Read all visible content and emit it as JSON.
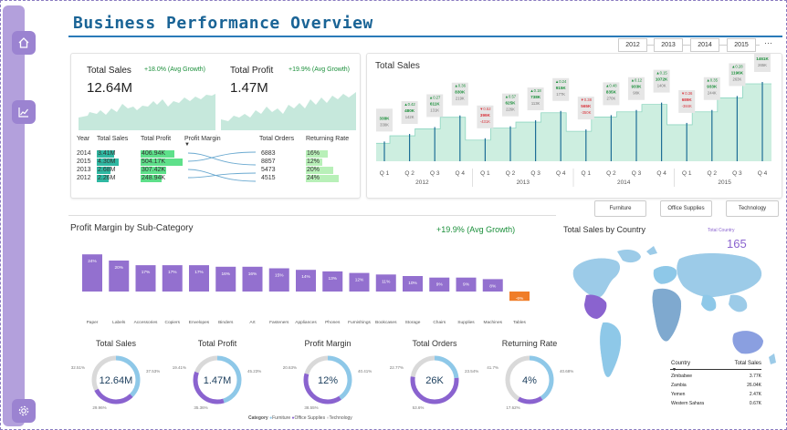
{
  "title": "Business Performance Overview",
  "year_buttons": [
    "2012",
    "2013",
    "2014",
    "2015"
  ],
  "kpis": {
    "total_sales": {
      "label": "Total Sales",
      "value": "12.64M",
      "growth": "+18.0% (Avg Growth)"
    },
    "total_profit": {
      "label": "Total Profit",
      "value": "1.47M",
      "growth": "+19.9% (Avg Growth)"
    }
  },
  "year_table": {
    "headers": [
      "Year",
      "Total Sales",
      "Total Profit",
      "Profit Margin",
      "Total Orders",
      "Returning Rate"
    ],
    "rows": [
      {
        "year": "2014",
        "sales": "3.41M",
        "profit": "406.94K",
        "orders": "6883",
        "rate": "16%",
        "sales_frac": 0.78,
        "profit_frac": 0.81,
        "rate_frac": 0.67
      },
      {
        "year": "2015",
        "sales": "4.30M",
        "profit": "504.17K",
        "orders": "8857",
        "rate": "12%",
        "sales_frac": 1.0,
        "profit_frac": 1.0,
        "rate_frac": 0.5
      },
      {
        "year": "2013",
        "sales": "2.68M",
        "profit": "307.42K",
        "orders": "5473",
        "rate": "20%",
        "sales_frac": 0.62,
        "profit_frac": 0.61,
        "rate_frac": 0.83
      },
      {
        "year": "2012",
        "sales": "2.26M",
        "profit": "248.94K",
        "orders": "4515",
        "rate": "24%",
        "sales_frac": 0.53,
        "profit_frac": 0.49,
        "rate_frac": 1.0
      }
    ]
  },
  "total_sales_chart": {
    "title": "Total Sales",
    "quarters": [
      "Q 1",
      "Q 2",
      "Q 3",
      "Q 4",
      "Q 1",
      "Q 2",
      "Q 3",
      "Q 4",
      "Q 1",
      "Q 2",
      "Q 3",
      "Q 4",
      "Q 1",
      "Q 2",
      "Q 3",
      "Q 4"
    ],
    "years": [
      "2012",
      "2013",
      "2014",
      "2015"
    ],
    "points": [
      {
        "val": "338K",
        "prev": "338K",
        "chg": "",
        "up": true
      },
      {
        "val": "480K",
        "prev": "142K",
        "chg": "▲0.42",
        "up": true
      },
      {
        "val": "611K",
        "prev": "131K",
        "chg": "▲0.27",
        "up": true
      },
      {
        "val": "830K",
        "prev": "219K",
        "chg": "▲0.36",
        "up": true
      },
      {
        "val": "399K",
        "prev": "-431K",
        "chg": "▼0.52",
        "up": false
      },
      {
        "val": "625K",
        "prev": "226K",
        "chg": "▲0.57",
        "up": true
      },
      {
        "val": "738K",
        "prev": "113K",
        "chg": "▲0.18",
        "up": true
      },
      {
        "val": "915K",
        "prev": "177K",
        "chg": "▲0.24",
        "up": true
      },
      {
        "val": "565K",
        "prev": "-350K",
        "chg": "▼0.38",
        "up": false
      },
      {
        "val": "835K",
        "prev": "270K",
        "chg": "▲0.48",
        "up": true
      },
      {
        "val": "933K",
        "prev": "98K",
        "chg": "▲0.12",
        "up": true
      },
      {
        "val": "1072K",
        "prev": "140K",
        "chg": "▲0.15",
        "up": true
      },
      {
        "val": "689K",
        "prev": "-384K",
        "chg": "▼0.36",
        "up": false
      },
      {
        "val": "933K",
        "prev": "244K",
        "chg": "▲0.35",
        "up": true
      },
      {
        "val": "1196K",
        "prev": "263K",
        "chg": "▲0.28",
        "up": true
      },
      {
        "val": "1461K",
        "prev": "265K",
        "chg": "▲0.24",
        "up": true
      }
    ]
  },
  "category_buttons": [
    "Furniture",
    "Office Supplies",
    "Technology"
  ],
  "chart_data": {
    "type": "bar",
    "title": "Profit Margin by Sub-Category",
    "growth": "+19.9% (Avg Growth)",
    "categories": [
      "Paper",
      "Labels",
      "Accessories",
      "Copiers",
      "Envelopes",
      "Binders",
      "Art",
      "Fasteners",
      "Appliances",
      "Phones",
      "Furnishings",
      "Bookcases",
      "Storage",
      "Chairs",
      "Supplies",
      "Machines",
      "Tables"
    ],
    "values": [
      24,
      20,
      17,
      17,
      17,
      16,
      16,
      15,
      14,
      13,
      12,
      11,
      10,
      9,
      9,
      8,
      -6
    ],
    "labels": [
      "24%",
      "20%",
      "17%",
      "17%",
      "17%",
      "16%",
      "16%",
      "15%",
      "14%",
      "13%",
      "12%",
      "11%",
      "10%",
      "9%",
      "9%",
      "8%",
      "-6%"
    ],
    "colors": {
      "positive": "#9370cf",
      "negative": "#f07d28"
    }
  },
  "donuts": [
    {
      "title": "Total Sales",
      "center": "12.64M",
      "labels": [
        "32.51%",
        "37.53%",
        "29.96%"
      ],
      "fracs": [
        0.3251,
        0.3753,
        0.2996
      ]
    },
    {
      "title": "Total Profit",
      "center": "1.47M",
      "labels": [
        "19.41%",
        "45.23%",
        "35.36%"
      ],
      "fracs": [
        0.1941,
        0.4523,
        0.3536
      ]
    },
    {
      "title": "Profit Margin",
      "center": "12%",
      "labels": [
        "20.63%",
        "40.41%",
        "38.55%"
      ],
      "fracs": [
        0.2063,
        0.4041,
        0.3896
      ]
    },
    {
      "title": "Total Orders",
      "center": "26K",
      "labels": [
        "22.77%",
        "23.54%",
        "53.6%"
      ],
      "fracs": [
        0.2277,
        0.2354,
        0.5369
      ]
    },
    {
      "title": "Returning Rate",
      "center": "4%",
      "labels": [
        "41.7%",
        "40.68%",
        "17.62%"
      ],
      "fracs": [
        0.417,
        0.4068,
        0.1762
      ]
    }
  ],
  "donut_legend": {
    "label": "Category",
    "items": [
      "Furniture",
      "Office Supplies",
      "Technology"
    ],
    "colors": [
      "#8ec8e8",
      "#8a63cf",
      "#d9d9d9"
    ]
  },
  "country": {
    "title": "Total Sales by Country",
    "selected_label": "Total Country",
    "selected_value": "165",
    "table_headers": [
      "Country",
      "Total Sales"
    ],
    "rows": [
      {
        "name": "Zimbabwe",
        "sales": "3.77K"
      },
      {
        "name": "Zambia",
        "sales": "26.04K"
      },
      {
        "name": "Yemen",
        "sales": "2.47K"
      },
      {
        "name": "Western Sahara",
        "sales": "0.67K"
      }
    ]
  },
  "colors": {
    "accent": "#1a6496",
    "purple": "#9370cf",
    "mint": "#c6e8dc",
    "green_bar": "#5ee08a",
    "light_green": "#b8f0b8"
  }
}
